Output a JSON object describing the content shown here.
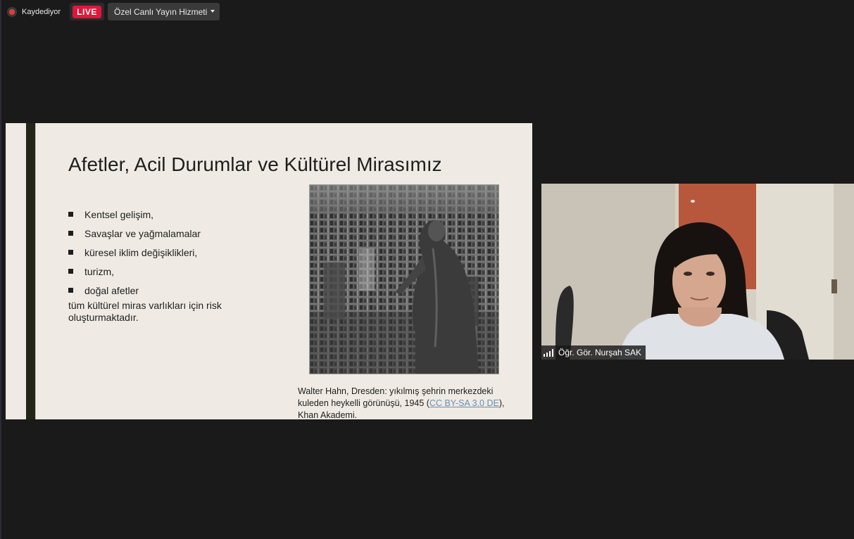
{
  "topbar": {
    "recording_label": "Kaydediyor",
    "live_label": "LIVE",
    "service_label": "Özel Canlı Yayın Hizmeti"
  },
  "slide": {
    "title": "Afetler, Acil Durumlar ve Kültürel Mirasımız",
    "bullets": [
      "Kentsel gelişim,",
      "Savaşlar ve yağmalamalar",
      "küresel iklim değişiklikleri,",
      "turizm,",
      "doğal afetler"
    ],
    "risk_text": "tüm kültürel miras varlıkları için risk oluşturmaktadır.",
    "caption": {
      "before_link": "Walter Hahn, Dresden: yıkılmış şehrin merkezdeki kuleden heykelli görünüşü, 1945 (",
      "link": "CC BY-SA 3.0 DE",
      "after_link": "), Khan Akademi."
    }
  },
  "webcam": {
    "participant_name": "Öğr. Gör. Nurşah SAK"
  },
  "colors": {
    "live_red": "#e0163a",
    "slide_bg": "#efebe4",
    "slide_bar": "#232516",
    "link": "#6a8fb4"
  }
}
